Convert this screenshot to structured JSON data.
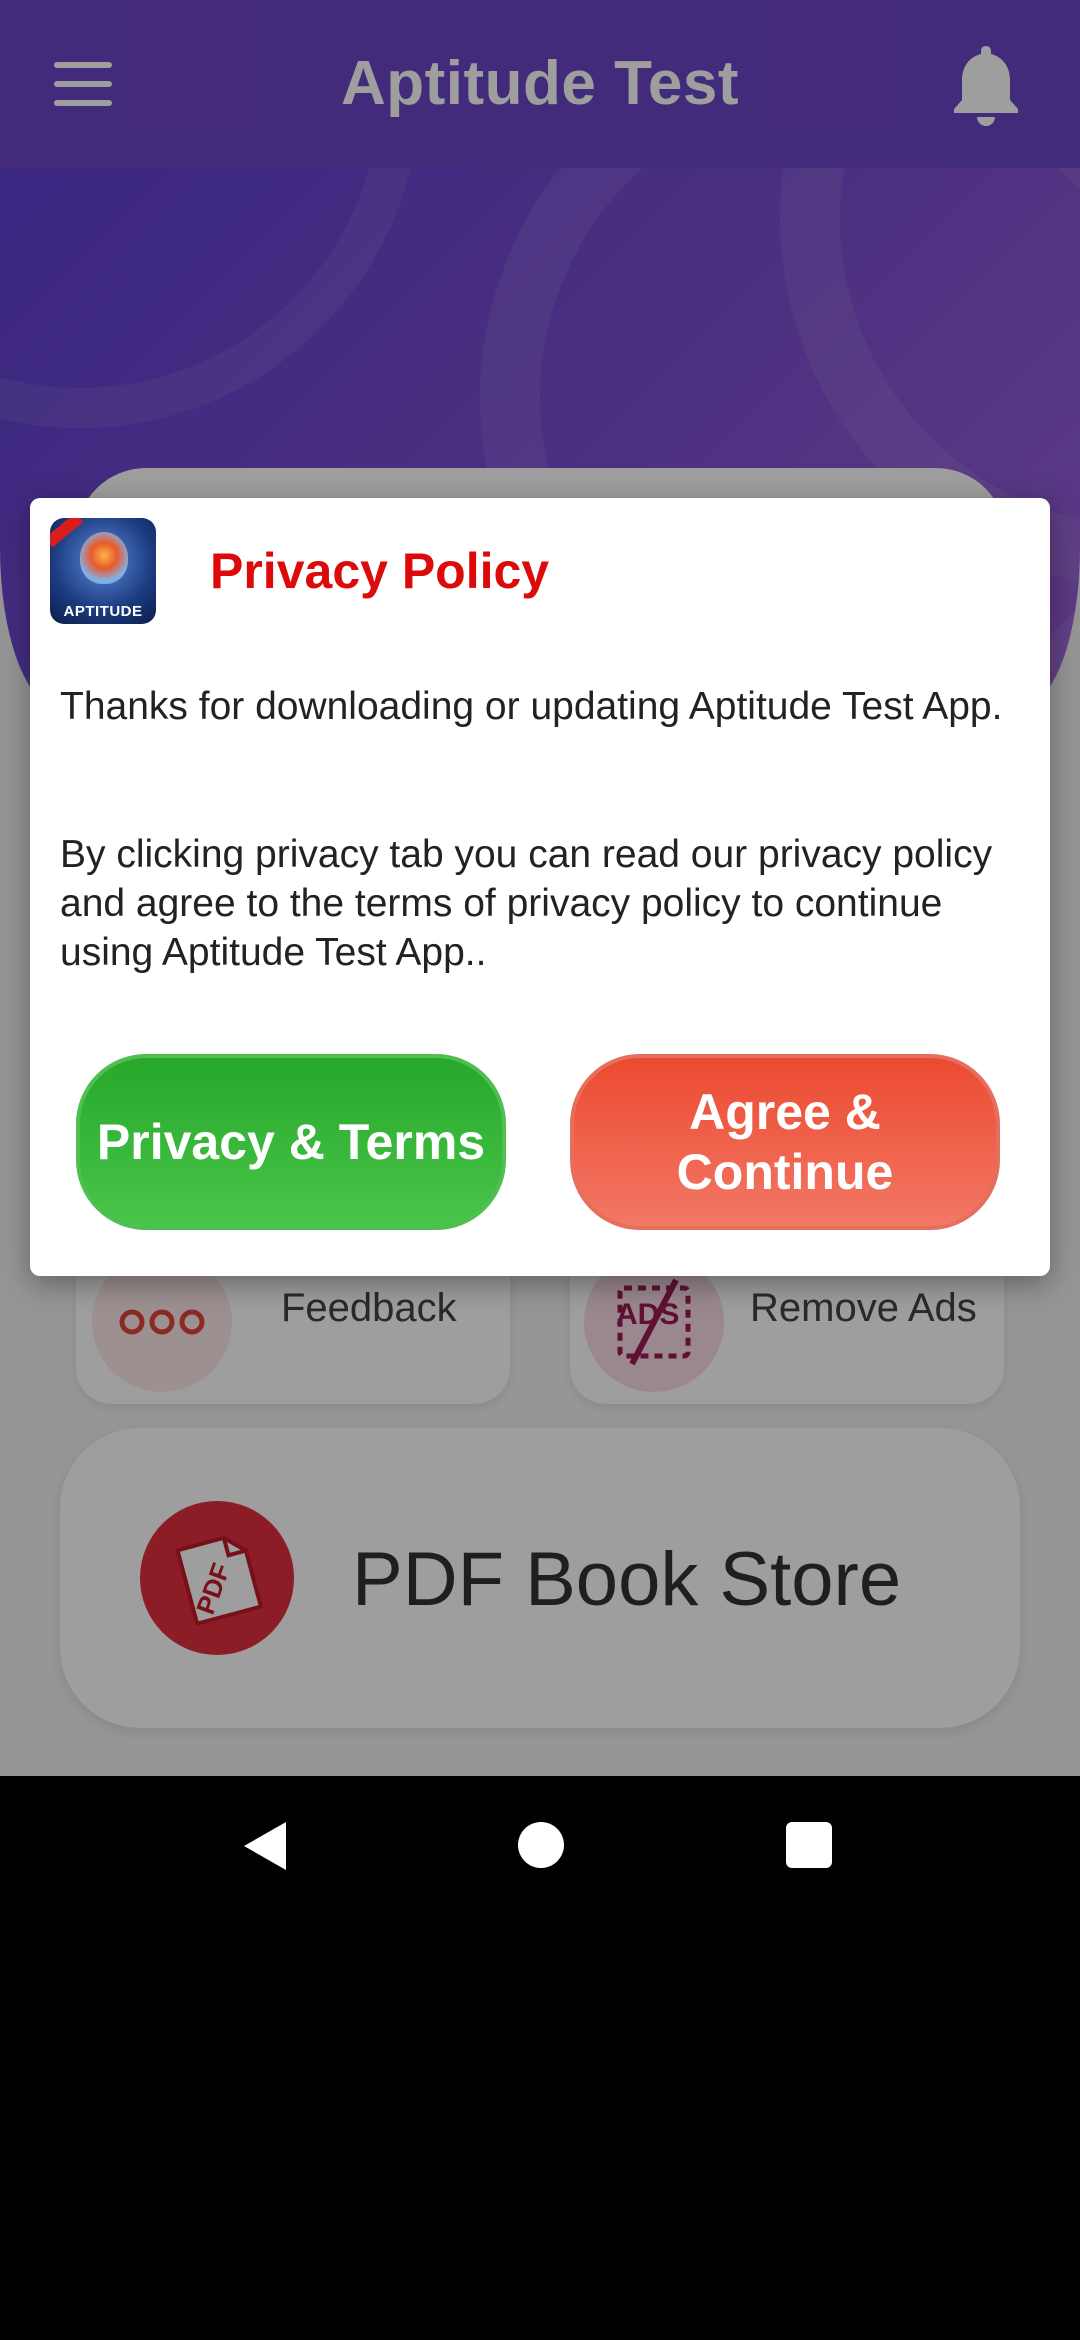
{
  "app_bar": {
    "title": "Aptitude Test"
  },
  "tiles": {
    "feedback_label": "Feedback",
    "remove_ads_label": "Remove Ads",
    "remove_ads_icon_text": "ADS"
  },
  "pdf_store": {
    "label": "PDF Book Store",
    "icon_text": "PDF"
  },
  "dialog": {
    "logo_text": "APTITUDE",
    "title": "Privacy Policy",
    "message_1": "Thanks for downloading or updating Aptitude Test App.",
    "message_2": "By clicking privacy tab you can read our privacy policy and agree to the terms of privacy policy to continue using Aptitude Test App..",
    "privacy_button_label": "Privacy & Terms",
    "agree_button_label": "Agree & Continue"
  },
  "colors": {
    "app_bar": "#6d46c8",
    "dialog_title": "#dd0a0a",
    "privacy_button": "#35b538",
    "agree_button": "#ef5a42"
  },
  "icons": {
    "menu": "menu-icon",
    "bell": "bell-icon",
    "feedback": "feedback-icon",
    "remove_ads": "remove-ads-icon",
    "pdf": "pdf-icon",
    "nav_back": "back-icon",
    "nav_home": "home-icon",
    "nav_recent": "recents-icon"
  }
}
